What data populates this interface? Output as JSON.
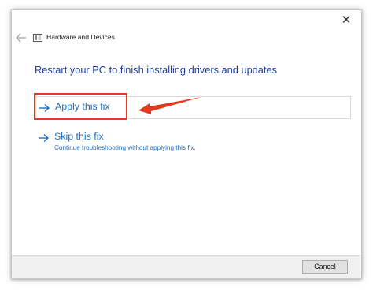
{
  "window": {
    "title": "Hardware and Devices",
    "close_glyph": "✕",
    "close_icon": "close-icon",
    "back_icon": "back-arrow-icon",
    "title_icon": "hardware-devices-icon"
  },
  "main": {
    "heading": "Restart your PC to finish installing drivers and updates",
    "options": [
      {
        "label": "Apply this fix",
        "description": "",
        "icon": "arrow-right-icon"
      },
      {
        "label": "Skip this fix",
        "description": "Continue troubleshooting without applying this fix.",
        "icon": "arrow-right-icon"
      }
    ]
  },
  "annotation": {
    "color": "#e23a1f",
    "type": "red-arrow-and-box"
  },
  "footer": {
    "cancel_label": "Cancel"
  },
  "colors": {
    "heading": "#1f3d9e",
    "link": "#1f6fc0",
    "footer_bg": "#f0f0f0"
  }
}
